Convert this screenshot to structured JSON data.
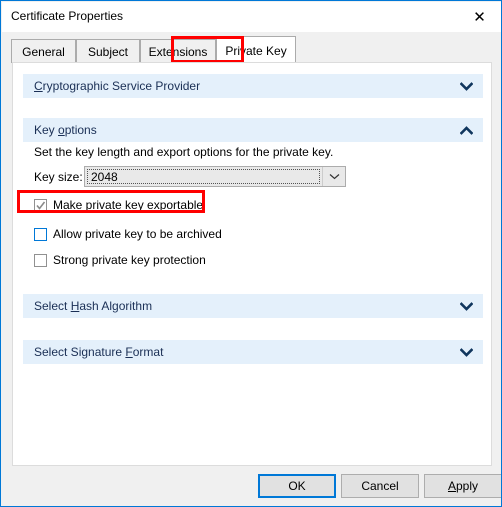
{
  "window": {
    "title": "Certificate Properties",
    "close_icon": "close-icon",
    "border_color": "#0078d7"
  },
  "tabs": [
    {
      "label": "General",
      "selected": false
    },
    {
      "label": "Subject",
      "selected": false
    },
    {
      "label": "Extensions",
      "selected": false
    },
    {
      "label": "Private Key",
      "selected": true
    }
  ],
  "highlights": {
    "color": "#ff0000",
    "tab": "Private Key",
    "checkbox": "Make private key exportable"
  },
  "sections": [
    {
      "title": "Cryptographic Service Provider",
      "accel": "C",
      "expanded": false,
      "chevron": "chevron-down-icon"
    },
    {
      "title": "Key options",
      "accel": "o",
      "expanded": true,
      "chevron": "chevron-up-icon"
    },
    {
      "title": "Select Hash Algorithm",
      "accel": "H",
      "expanded": false,
      "chevron": "chevron-down-icon"
    },
    {
      "title": "Select Signature Format",
      "accel": "F",
      "expanded": false,
      "chevron": "chevron-down-icon"
    }
  ],
  "key_options": {
    "description": "Set the key length and export options for the private key.",
    "key_size_label": "Key size:",
    "key_size_value": "2048",
    "dropdown_icon": "chevron-down-icon",
    "checkboxes": [
      {
        "label": "Make private key exportable",
        "checked": true,
        "focused": false
      },
      {
        "label": "Allow private key to be archived",
        "checked": false,
        "focused": true
      },
      {
        "label": "Strong private key protection",
        "checked": false,
        "focused": false
      }
    ]
  },
  "footer": {
    "ok": "OK",
    "cancel": "Cancel",
    "apply": "Apply",
    "apply_accel": "A"
  }
}
